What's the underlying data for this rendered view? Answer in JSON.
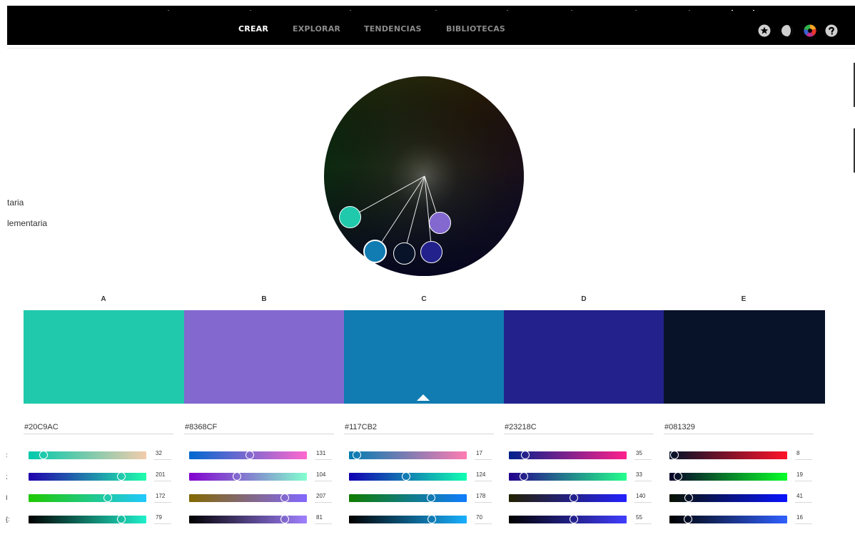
{
  "topbar": {
    "nav": [
      {
        "label": "CREAR",
        "active": true
      },
      {
        "label": "EXPLORAR",
        "active": false
      },
      {
        "label": "TENDENCIAS",
        "active": false
      },
      {
        "label": "BIBLIOTECAS",
        "active": false
      }
    ],
    "icons": [
      "star-badge-icon",
      "contrast-icon",
      "color-wheel-icon",
      "help-icon"
    ]
  },
  "rules": {
    "items": [
      {
        "label": "taria"
      },
      {
        "label": "lementaria"
      }
    ]
  },
  "theme": {
    "columns": [
      {
        "label": "A",
        "color": "#20C9AC",
        "hex": "#20C9AC",
        "values": [
          "32",
          "201",
          "172",
          "79"
        ]
      },
      {
        "label": "B",
        "color": "#8368CF",
        "hex": "#8368CF",
        "values": [
          "131",
          "104",
          "207",
          "81"
        ]
      },
      {
        "label": "C",
        "color": "#117CB2",
        "hex": "#117CB2",
        "values": [
          "17",
          "124",
          "178",
          "70"
        ],
        "selected": true
      },
      {
        "label": "D",
        "color": "#23218C",
        "hex": "#23218C",
        "values": [
          "35",
          "33",
          "140",
          "55"
        ]
      },
      {
        "label": "E",
        "color": "#081329",
        "hex": "#081329",
        "values": [
          "8",
          "19",
          "41",
          "16"
        ]
      }
    ],
    "channel_rows": [
      ":",
      ";",
      "I",
      "{:"
    ]
  }
}
